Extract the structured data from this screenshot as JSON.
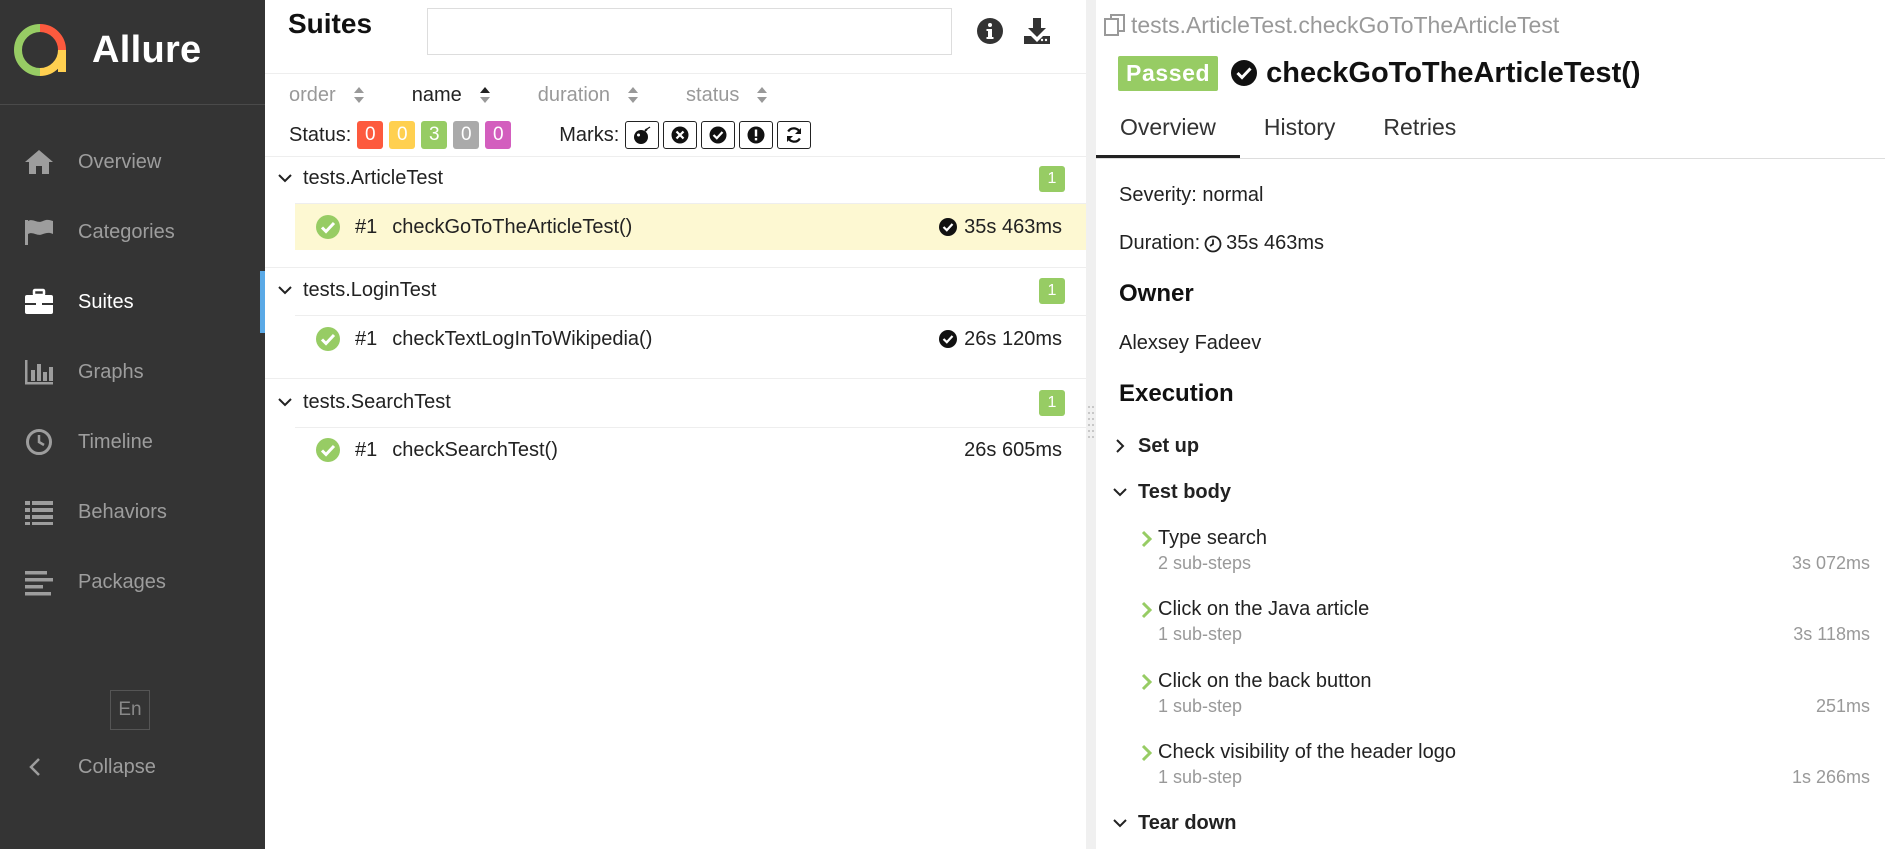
{
  "sidebar": {
    "brand": "Allure",
    "items": [
      {
        "label": "Overview",
        "icon": "home-icon"
      },
      {
        "label": "Categories",
        "icon": "flag-icon"
      },
      {
        "label": "Suites",
        "icon": "briefcase-icon"
      },
      {
        "label": "Graphs",
        "icon": "bar-chart-icon"
      },
      {
        "label": "Timeline",
        "icon": "clock-icon"
      },
      {
        "label": "Behaviors",
        "icon": "list-icon"
      },
      {
        "label": "Packages",
        "icon": "align-left-icon"
      }
    ],
    "active_item": "Suites",
    "language": "En",
    "collapse_label": "Collapse"
  },
  "suites_pane": {
    "title": "Suites",
    "search": {
      "value": "",
      "placeholder": ""
    },
    "sorters": [
      {
        "label": "order",
        "active": false
      },
      {
        "label": "name",
        "active": true
      },
      {
        "label": "duration",
        "active": false
      },
      {
        "label": "status",
        "active": false
      }
    ],
    "status_label": "Status:",
    "status_counts": [
      {
        "status": "failed",
        "count": "0",
        "color": "#fd5a3e"
      },
      {
        "status": "broken",
        "count": "0",
        "color": "#ffd050"
      },
      {
        "status": "passed",
        "count": "3",
        "color": "#97cc64"
      },
      {
        "status": "skipped",
        "count": "0",
        "color": "#aaaaaa"
      },
      {
        "status": "unknown",
        "count": "0",
        "color": "#d35ebe"
      }
    ],
    "marks_label": "Marks:",
    "marks": [
      "bomb-icon",
      "times-circle-icon",
      "check-circle-icon",
      "exclamation-circle-icon",
      "refresh-icon"
    ],
    "groups": [
      {
        "name": "tests.ArticleTest",
        "count": "1",
        "tests": [
          {
            "num": "#1",
            "name": "checkGoToTheArticleTest()",
            "duration": "35s 463ms",
            "flag_icon": true,
            "selected": true
          }
        ]
      },
      {
        "name": "tests.LoginTest",
        "count": "1",
        "tests": [
          {
            "num": "#1",
            "name": "checkTextLogInToWikipedia()",
            "duration": "26s 120ms",
            "flag_icon": true,
            "selected": false
          }
        ]
      },
      {
        "name": "tests.SearchTest",
        "count": "1",
        "tests": [
          {
            "num": "#1",
            "name": "checkSearchTest()",
            "duration": "26s 605ms",
            "flag_icon": false,
            "selected": false
          }
        ]
      }
    ]
  },
  "details": {
    "breadcrumb": "tests.ArticleTest.checkGoToTheArticleTest",
    "status_badge": "Passed",
    "title": "checkGoToTheArticleTest()",
    "tabs": [
      {
        "label": "Overview",
        "active": true
      },
      {
        "label": "History",
        "active": false
      },
      {
        "label": "Retries",
        "active": false
      }
    ],
    "severity_text": "Severity: normal",
    "duration_label": "Duration:",
    "duration_value": "35s 463ms",
    "owner_heading": "Owner",
    "owner_name": "Alexsey Fadeev",
    "execution_heading": "Execution",
    "setup_label": "Set up",
    "test_body_label": "Test body",
    "steps": [
      {
        "name": "Type search",
        "sub": "2 sub-steps",
        "duration": "3s 072ms"
      },
      {
        "name": "Click on the Java article",
        "sub": "1 sub-step",
        "duration": "3s 118ms"
      },
      {
        "name": "Click on the back button",
        "sub": "1 sub-step",
        "duration": "251ms"
      },
      {
        "name": "Check visibility of the header logo",
        "sub": "1 sub-step",
        "duration": "1s 266ms"
      }
    ],
    "teardown_label": "Tear down"
  },
  "colors": {
    "sidebar_bg": "#343434",
    "accent": "#5aa9e6",
    "passed": "#97cc64",
    "selected_row": "#fdf8d2"
  }
}
